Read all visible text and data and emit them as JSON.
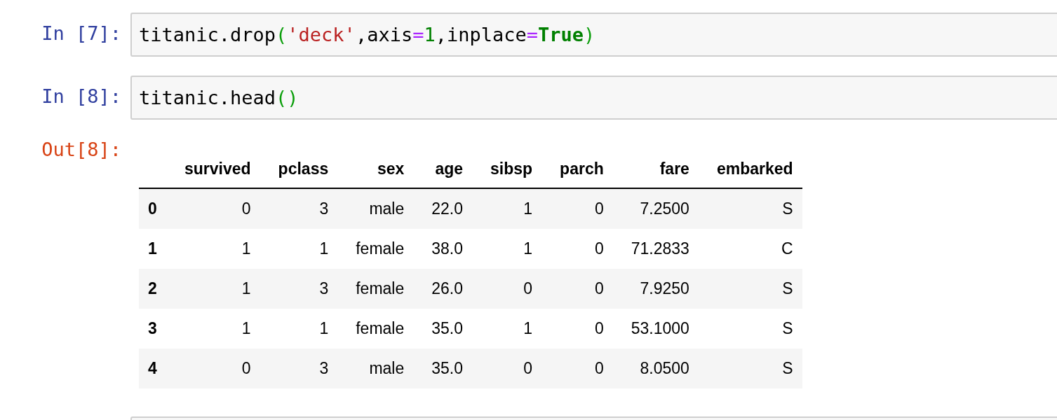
{
  "cells": [
    {
      "kind": "input",
      "prompt": "In [7]:",
      "code": [
        {
          "kind": "name",
          "text": "titanic.drop"
        },
        {
          "kind": "paren",
          "text": "("
        },
        {
          "kind": "string",
          "text": "'deck'"
        },
        {
          "kind": "name",
          "text": ",axis"
        },
        {
          "kind": "operator",
          "text": "="
        },
        {
          "kind": "number",
          "text": "1"
        },
        {
          "kind": "name",
          "text": ",inplace"
        },
        {
          "kind": "operator",
          "text": "="
        },
        {
          "kind": "keyword",
          "text": "True"
        },
        {
          "kind": "paren",
          "text": ")"
        }
      ]
    },
    {
      "kind": "input",
      "prompt": "In [8]:",
      "code": [
        {
          "kind": "name",
          "text": "titanic.head"
        },
        {
          "kind": "paren",
          "text": "()"
        }
      ]
    },
    {
      "kind": "output",
      "prompt": "Out[8]:",
      "table": {
        "columns": [
          "survived",
          "pclass",
          "sex",
          "age",
          "sibsp",
          "parch",
          "fare",
          "embarked"
        ],
        "rows": [
          {
            "index": "0",
            "cells": [
              "0",
              "3",
              "male",
              "22.0",
              "1",
              "0",
              "7.2500",
              "S"
            ]
          },
          {
            "index": "1",
            "cells": [
              "1",
              "1",
              "female",
              "38.0",
              "1",
              "0",
              "71.2833",
              "C"
            ]
          },
          {
            "index": "2",
            "cells": [
              "1",
              "3",
              "female",
              "26.0",
              "0",
              "0",
              "7.9250",
              "S"
            ]
          },
          {
            "index": "3",
            "cells": [
              "1",
              "1",
              "female",
              "35.0",
              "1",
              "0",
              "53.1000",
              "S"
            ]
          },
          {
            "index": "4",
            "cells": [
              "0",
              "3",
              "male",
              "35.0",
              "0",
              "0",
              "8.0500",
              "S"
            ]
          }
        ]
      }
    },
    {
      "kind": "input"
    }
  ]
}
